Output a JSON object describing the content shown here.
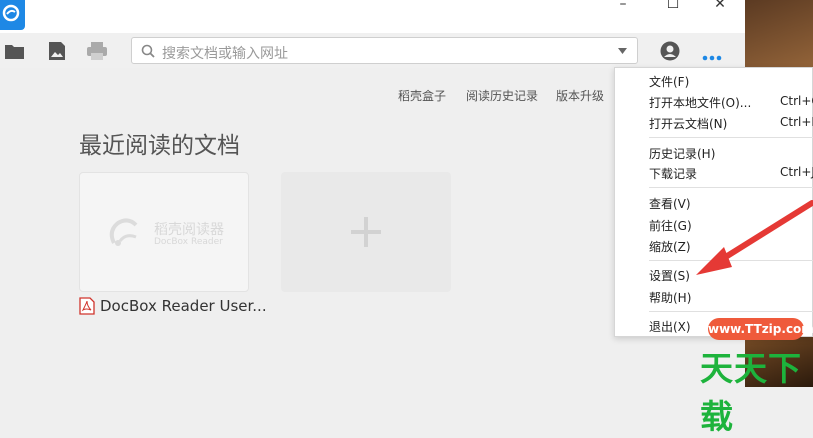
{
  "window": {
    "minimize_icon": "–",
    "maximize_icon": "☐",
    "close_icon": "✕"
  },
  "search": {
    "placeholder": "搜索文档或输入网址"
  },
  "nav": {
    "links": [
      "稻壳盒子",
      "阅读历史记录",
      "版本升级"
    ]
  },
  "recent": {
    "title": "最近阅读的文档",
    "card_logo_cn": "稻壳阅读器",
    "card_logo_en": "DocBox Reader",
    "doc_name": "DocBox Reader User..."
  },
  "menu": {
    "items": [
      {
        "label": "文件(F)",
        "shortcut": ""
      },
      {
        "label": "打开本地文件(O)...",
        "shortcut": "Ctrl+C"
      },
      {
        "label": "打开云文档(N)",
        "shortcut": "Ctrl+N"
      },
      {
        "label": "历史记录(H)",
        "shortcut": ""
      },
      {
        "label": "下载记录",
        "shortcut": "Ctrl+J"
      },
      {
        "label": "查看(V)",
        "shortcut": ""
      },
      {
        "label": "前往(G)",
        "shortcut": ""
      },
      {
        "label": "缩放(Z)",
        "shortcut": ""
      },
      {
        "label": "设置(S)",
        "shortcut": ""
      },
      {
        "label": "帮助(H)",
        "shortcut": ""
      },
      {
        "label": "退出(X)",
        "shortcut": ""
      }
    ]
  },
  "watermark": {
    "site": "www.TTzip.com",
    "brand": "天天下载"
  },
  "colors": {
    "accent": "#1e88e5",
    "arrow": "#e53935",
    "watermark_green": "#1db33c",
    "watermark_pill": "#ef5a3b"
  },
  "icons": [
    "app-logo-icon",
    "folder-icon",
    "image-icon",
    "printer-icon",
    "search-icon",
    "dropdown-caret-icon",
    "account-icon",
    "more-icon",
    "pdf-icon",
    "plus-icon"
  ]
}
